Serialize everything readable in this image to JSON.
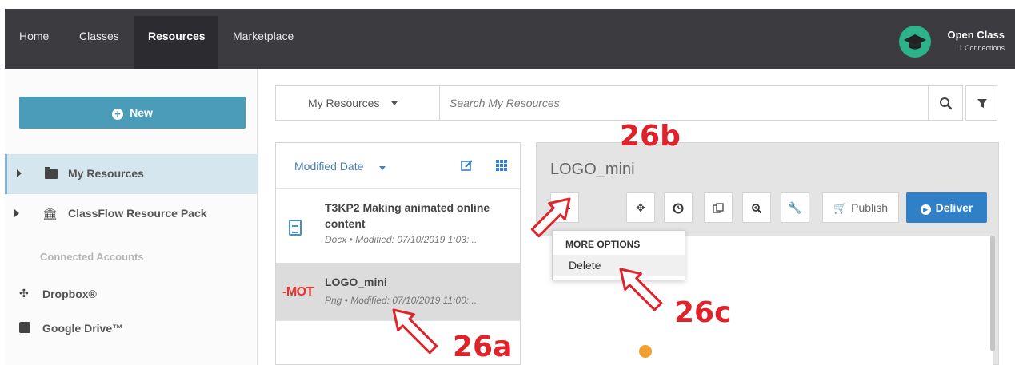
{
  "nav": {
    "items": [
      {
        "label": "Home"
      },
      {
        "label": "Classes"
      },
      {
        "label": "Resources"
      },
      {
        "label": "Marketplace"
      }
    ],
    "active": "Resources",
    "profile": {
      "name": "Open Class",
      "subtitle": "1 Connections",
      "avatar_icon": "graduation-cap-icon"
    }
  },
  "sidebar": {
    "new_button": "New",
    "tree": [
      {
        "label": "My Resources",
        "icon": "folder-icon",
        "selected": true
      },
      {
        "label": "ClassFlow Resource Pack",
        "icon": "bank-icon",
        "selected": false
      }
    ],
    "connected_heading": "Connected Accounts",
    "accounts": [
      {
        "label": "Dropbox®",
        "icon": "dropbox-icon"
      },
      {
        "label": "Google Drive™",
        "icon": "google-drive-icon"
      }
    ]
  },
  "search": {
    "scope": "My Resources",
    "placeholder": "Search My Resources"
  },
  "list": {
    "sort_label": "Modified Date",
    "items": [
      {
        "title_line1": "T3KP2 Making animated online",
        "title_line2": "content",
        "meta": "Docx  •  Modified: 07/10/2019 1:03:...",
        "thumb": "doc-icon"
      },
      {
        "title_line1": "LOGO_mini",
        "title_line2": "",
        "meta": "Png  •  Modified: 07/10/2019 11:00:...",
        "thumb_text": "-MOT"
      }
    ]
  },
  "detail": {
    "title": "LOGO_mini",
    "toolbar": {
      "publish": "Publish",
      "deliver": "Deliver",
      "tools": [
        "settings-icon",
        "move-icon",
        "clock-icon",
        "copy-icon",
        "zoom-icon",
        "wrench-icon"
      ]
    },
    "menu": {
      "heading": "MORE OPTIONS",
      "items": [
        "Delete"
      ]
    }
  },
  "annotations": {
    "a": "26a",
    "b": "26b",
    "c": "26c",
    "color": "#e0222a"
  }
}
